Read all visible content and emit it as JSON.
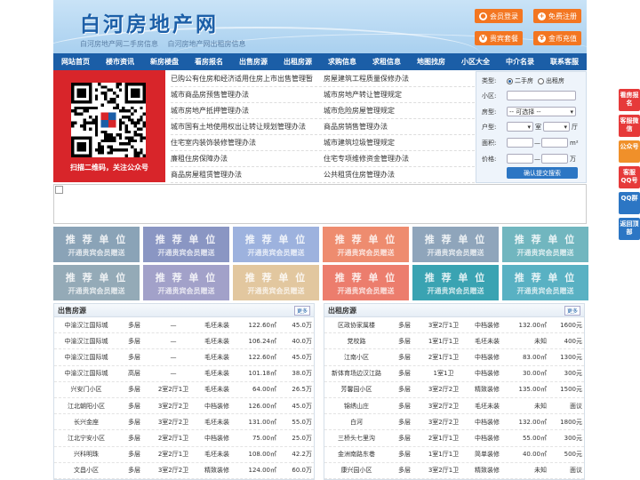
{
  "header": {
    "title": "白河房地产网",
    "subtitle_links": [
      "白河房地产网二手房信息",
      "白河房地产网出租房信息"
    ],
    "buttons": [
      {
        "label": "会员登录",
        "icon": "user-icon"
      },
      {
        "label": "免费注册",
        "icon": "person-add-icon"
      },
      {
        "label": "贵宾套餐",
        "icon": "vip-icon"
      },
      {
        "label": "金币充值",
        "icon": "coin-icon"
      }
    ]
  },
  "nav": [
    "网站首页",
    "楼市资讯",
    "新房楼盘",
    "看房报名",
    "出售房源",
    "出租房源",
    "求购信息",
    "求租信息",
    "地图找房",
    "小区大全",
    "中介名录",
    "联系客服"
  ],
  "qr": {
    "caption": "扫描二维码，关注公众号"
  },
  "news_left": [
    "已购公有住房和经济适用住房上市出售管理暂",
    "城市商品房预售管理办法",
    "城市房地产抵押管理办法",
    "城市国有土地使用权出让转让规划管理办法",
    "住宅室内装饰装修管理办法",
    "廉租住房保障办法",
    "商品房屋租赁管理办法"
  ],
  "news_right": [
    "房屋建筑工程质量保修办法",
    "城市房地产转让管理规定",
    "城市危险房屋管理规定",
    "商品房销售管理办法",
    "城市建筑垃圾管理规定",
    "住宅专项维修资金管理办法",
    "公共租赁住房管理办法"
  ],
  "search": {
    "type_label": "类型:",
    "type_options": [
      "二手房",
      "出租房"
    ],
    "type_selected": "二手房",
    "community_label": "小区:",
    "community_value": "",
    "housetype_label": "房型:",
    "housetype_value": "-- 可选择 --",
    "layout_label": "户型:",
    "layout_unit_room": "室",
    "layout_unit_hall": "厅",
    "area_label": "面积:",
    "area_sep": "—",
    "area_unit": "m²",
    "price_label": "价格:",
    "price_sep": "—",
    "price_unit": "万",
    "submit_label": "确认提交搜索"
  },
  "recommend": {
    "title": "推 荐 单 位",
    "sub": "开通贵宾会员赠送",
    "colors": [
      "#8aa3b7",
      "#8a96c3",
      "#9db2de",
      "#ee8c6f",
      "#8fa5bb",
      "#71b6bf",
      "#94aab7",
      "#a2a1c9",
      "#e2c79f",
      "#ec7d6d",
      "#3aa3b2",
      "#59b1c3"
    ]
  },
  "sale": {
    "title": "出售房源",
    "more": "更多",
    "rows": [
      [
        "中渝汉江国际城",
        "多层",
        "—",
        "毛坯未装",
        "122.60㎡",
        "45.0万"
      ],
      [
        "中渝汉江国际城",
        "多层",
        "—",
        "毛坯未装",
        "106.24㎡",
        "40.0万"
      ],
      [
        "中渝汉江国际城",
        "多层",
        "—",
        "毛坯未装",
        "122.60㎡",
        "45.0万"
      ],
      [
        "中渝汉江国际城",
        "高层",
        "—",
        "毛坯未装",
        "101.18㎡",
        "38.0万"
      ],
      [
        "兴安门小区",
        "多层",
        "2室2厅1卫",
        "毛坯未装",
        "64.00㎡",
        "26.5万"
      ],
      [
        "江北朝阳小区",
        "多层",
        "3室2厅2卫",
        "中档装修",
        "126.00㎡",
        "45.0万"
      ],
      [
        "长兴金座",
        "多层",
        "3室2厅2卫",
        "毛坯未装",
        "131.00㎡",
        "55.0万"
      ],
      [
        "江北宁安小区",
        "多层",
        "2室2厅1卫",
        "中档装修",
        "75.00㎡",
        "25.0万"
      ],
      [
        "兴科明珠",
        "多层",
        "2室2厅1卫",
        "毛坯未装",
        "108.00㎡",
        "42.2万"
      ],
      [
        "文昌小区",
        "多层",
        "3室2厅2卫",
        "精致装修",
        "124.00㎡",
        "60.0万"
      ]
    ]
  },
  "rent": {
    "title": "出租房源",
    "more": "更多",
    "rows": [
      [
        "区政协家属楼",
        "多层",
        "3室2厅1卫",
        "中档装修",
        "132.00㎡",
        "1600元"
      ],
      [
        "党校路",
        "多层",
        "1室1厅1卫",
        "毛坯未装",
        "未知",
        "400元"
      ],
      [
        "江南小区",
        "多层",
        "2室1厅1卫",
        "中档装修",
        "83.00㎡",
        "1300元"
      ],
      [
        "新体育场边汉江路",
        "多层",
        "1室1卫",
        "中档装修",
        "30.00㎡",
        "300元"
      ],
      [
        "芳馨园小区",
        "多层",
        "3室2厅2卫",
        "精致装修",
        "135.00㎡",
        "1500元"
      ],
      [
        "锦绣山庄",
        "多层",
        "3室2厅2卫",
        "毛坯未装",
        "未知",
        "面议"
      ],
      [
        "白河",
        "多层",
        "3室2厅2卫",
        "中档装修",
        "132.00㎡",
        "1800元"
      ],
      [
        "三桥头七里沟",
        "多层",
        "2室1厅1卫",
        "中档装修",
        "55.00㎡",
        "300元"
      ],
      [
        "金洲南路东巷",
        "多层",
        "1室1厅1卫",
        "简单装修",
        "40.00㎡",
        "500元"
      ],
      [
        "康兴园小区",
        "多层",
        "3室2厅1卫",
        "精致装修",
        "未知",
        "面议"
      ]
    ]
  },
  "side": [
    {
      "label": "看房报名",
      "color": "#e63a3a"
    },
    {
      "label": "客服微信",
      "color": "#e63a3a"
    },
    {
      "label": "公众号",
      "color": "#f0902a"
    },
    {
      "label": "客服QQ号",
      "color": "#e63a3a"
    },
    {
      "label": "QQ群",
      "color": "#2c76c4"
    },
    {
      "label": "返回顶部",
      "color": "#2c76c4"
    }
  ]
}
